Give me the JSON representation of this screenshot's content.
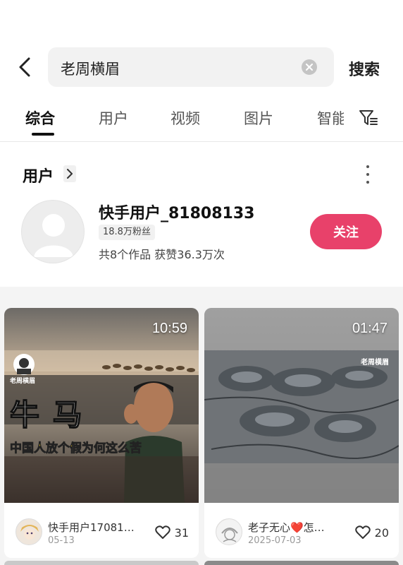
{
  "search": {
    "query": "老周横眉",
    "submit_label": "搜索"
  },
  "tabs": [
    {
      "label": "综合",
      "active": true
    },
    {
      "label": "用户",
      "active": false
    },
    {
      "label": "视频",
      "active": false
    },
    {
      "label": "图片",
      "active": false
    },
    {
      "label": "智能",
      "active": false
    }
  ],
  "user_section": {
    "title": "用户",
    "user": {
      "name": "快手用户_81808133",
      "fans_badge": "18.8万粉丝",
      "stats": "共8个作品 获赞36.3万次",
      "follow_label": "关注"
    }
  },
  "cards": [
    {
      "duration": "10:59",
      "author": "快手用户17081…",
      "date": "05-13",
      "likes": "31",
      "overlay_title": "牛 马",
      "overlay_subtitle": "中国人放个假为何这么苦",
      "channel_mark": "老周横眉"
    },
    {
      "duration": "01:47",
      "author": "老子无心❤️怎…",
      "date": "2025-07-03",
      "likes": "20",
      "channel_mark": "老周横眉"
    }
  ],
  "colors": {
    "accent": "#e8416a",
    "search_bg": "#f2f2f2",
    "feed_bg": "#f4f4f4"
  }
}
